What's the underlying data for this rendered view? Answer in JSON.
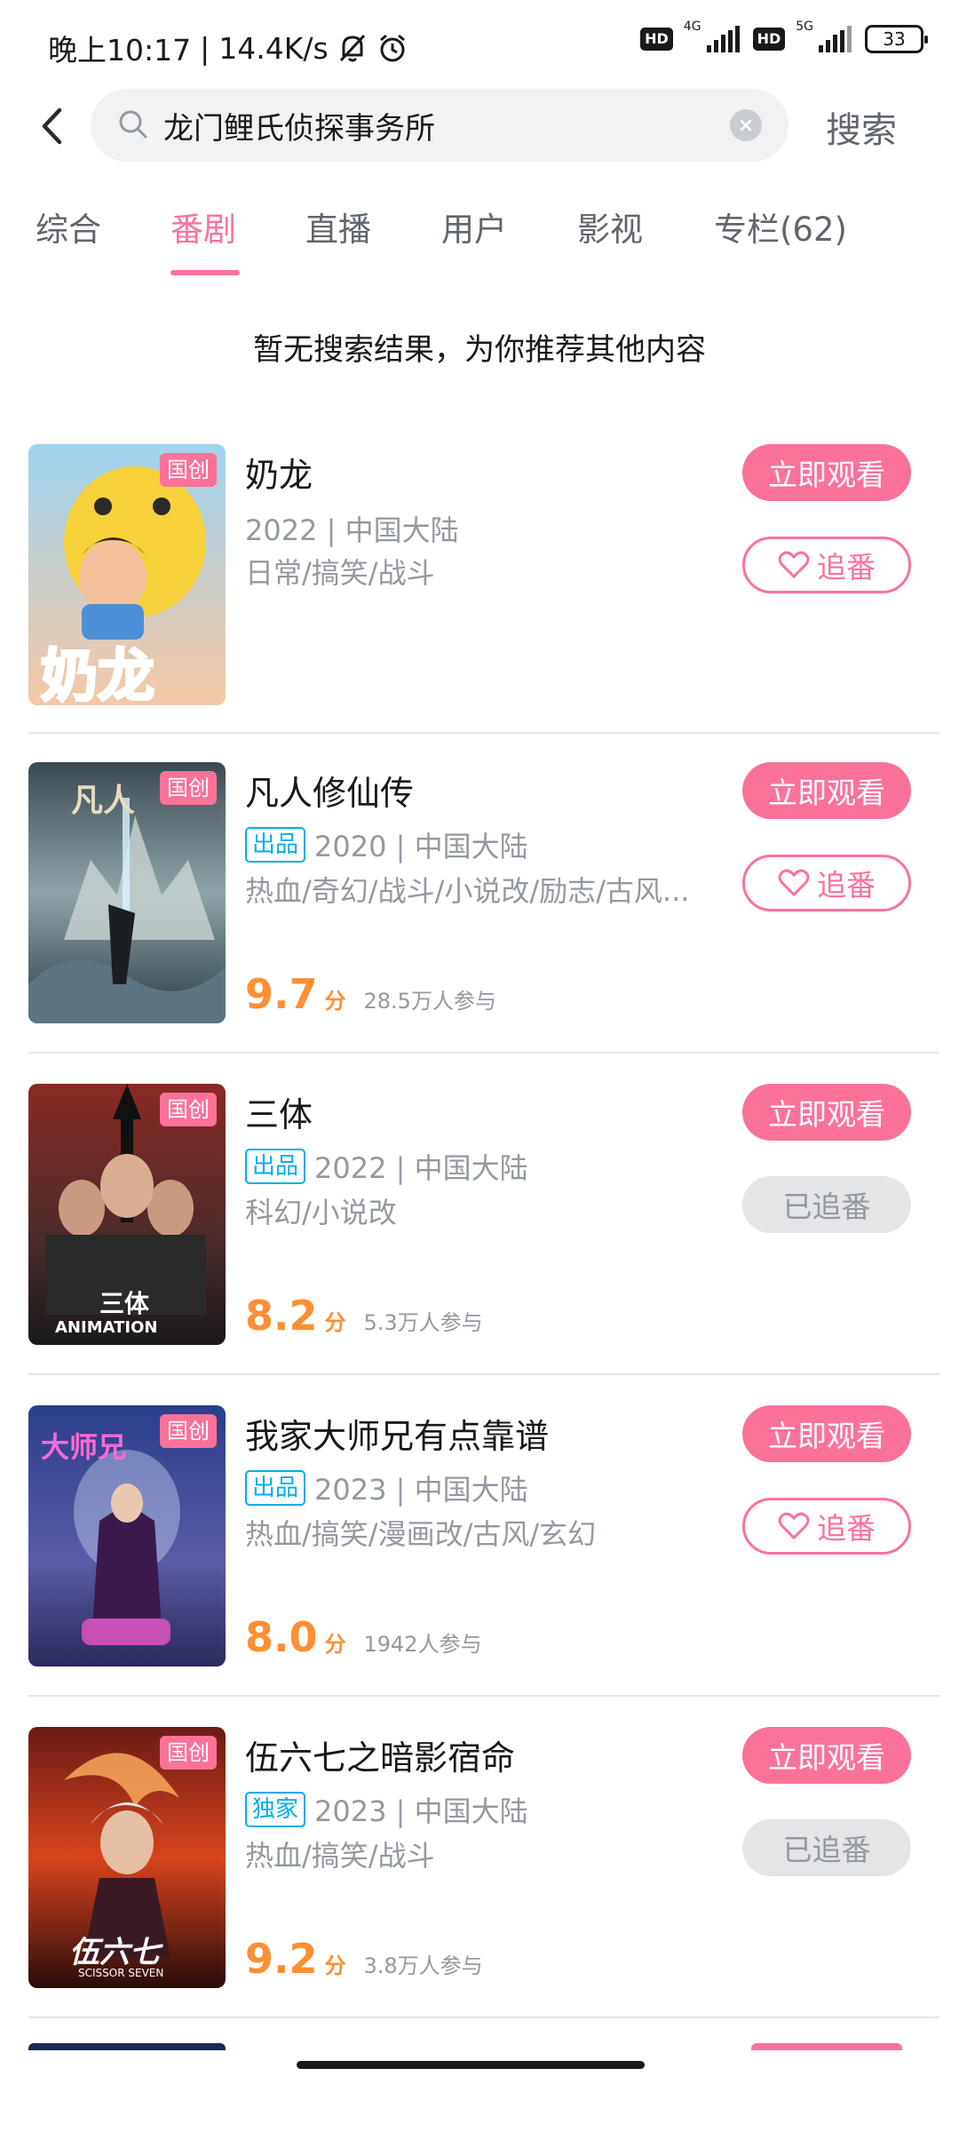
{
  "status_bar": {
    "time": "晚上10:17",
    "separator": "|",
    "speed": "14.4K/s",
    "icons": [
      "mute-bell-icon",
      "alarm-icon"
    ],
    "hd1": "HD",
    "net1": "4G",
    "hd2": "HD",
    "net2": "5G",
    "battery": "33"
  },
  "search": {
    "query": "龙门鲤氏侦探事务所",
    "submit_label": "搜索"
  },
  "tabs": [
    "综合",
    "番剧",
    "直播",
    "用户",
    "影视",
    "专栏(62)"
  ],
  "active_tab": "番剧",
  "no_result_text": "暂无搜索结果，为你推荐其他内容",
  "colors": {
    "accent": "#fb7299",
    "score": "#ff8f34",
    "source_tag": "#00aeec"
  },
  "watch_label": "立即观看",
  "follow_label": "追番",
  "followed_label": "已追番",
  "items": [
    {
      "title": "奶龙",
      "badge": "国创",
      "source": "",
      "year_region": "2022 | 中国大陆",
      "tags": "日常/搞笑/战斗",
      "score": "",
      "score_unit": "",
      "participants": "",
      "followed": false,
      "cover_text": "奶龙"
    },
    {
      "title": "凡人修仙传",
      "badge": "国创",
      "source": "出品",
      "year_region": "2020 | 中国大陆",
      "tags": "热血/奇幻/战斗/小说改/励志/古风...",
      "score": "9.7",
      "score_unit": "分",
      "participants": "28.5万人参与",
      "followed": false,
      "cover_text": "凡人"
    },
    {
      "title": "三体",
      "badge": "国创",
      "source": "出品",
      "year_region": "2022 | 中国大陆",
      "tags": "科幻/小说改",
      "score": "8.2",
      "score_unit": "分",
      "participants": "5.3万人参与",
      "followed": true,
      "cover_text": "三体",
      "cover_subtext": "ANIMATION"
    },
    {
      "title": "我家大师兄有点靠谱",
      "badge": "国创",
      "source": "出品",
      "year_region": "2023 | 中国大陆",
      "tags": "热血/搞笑/漫画改/古风/玄幻",
      "score": "8.0",
      "score_unit": "分",
      "participants": "1942人参与",
      "followed": false,
      "cover_text": "大师兄"
    },
    {
      "title": "伍六七之暗影宿命",
      "badge": "国创",
      "source": "独家",
      "year_region": "2023 | 中国大陆",
      "tags": "热血/搞笑/战斗",
      "score": "9.2",
      "score_unit": "分",
      "participants": "3.8万人参与",
      "followed": true,
      "cover_text": "伍六七",
      "cover_subtext": "SCISSOR SEVEN"
    }
  ]
}
